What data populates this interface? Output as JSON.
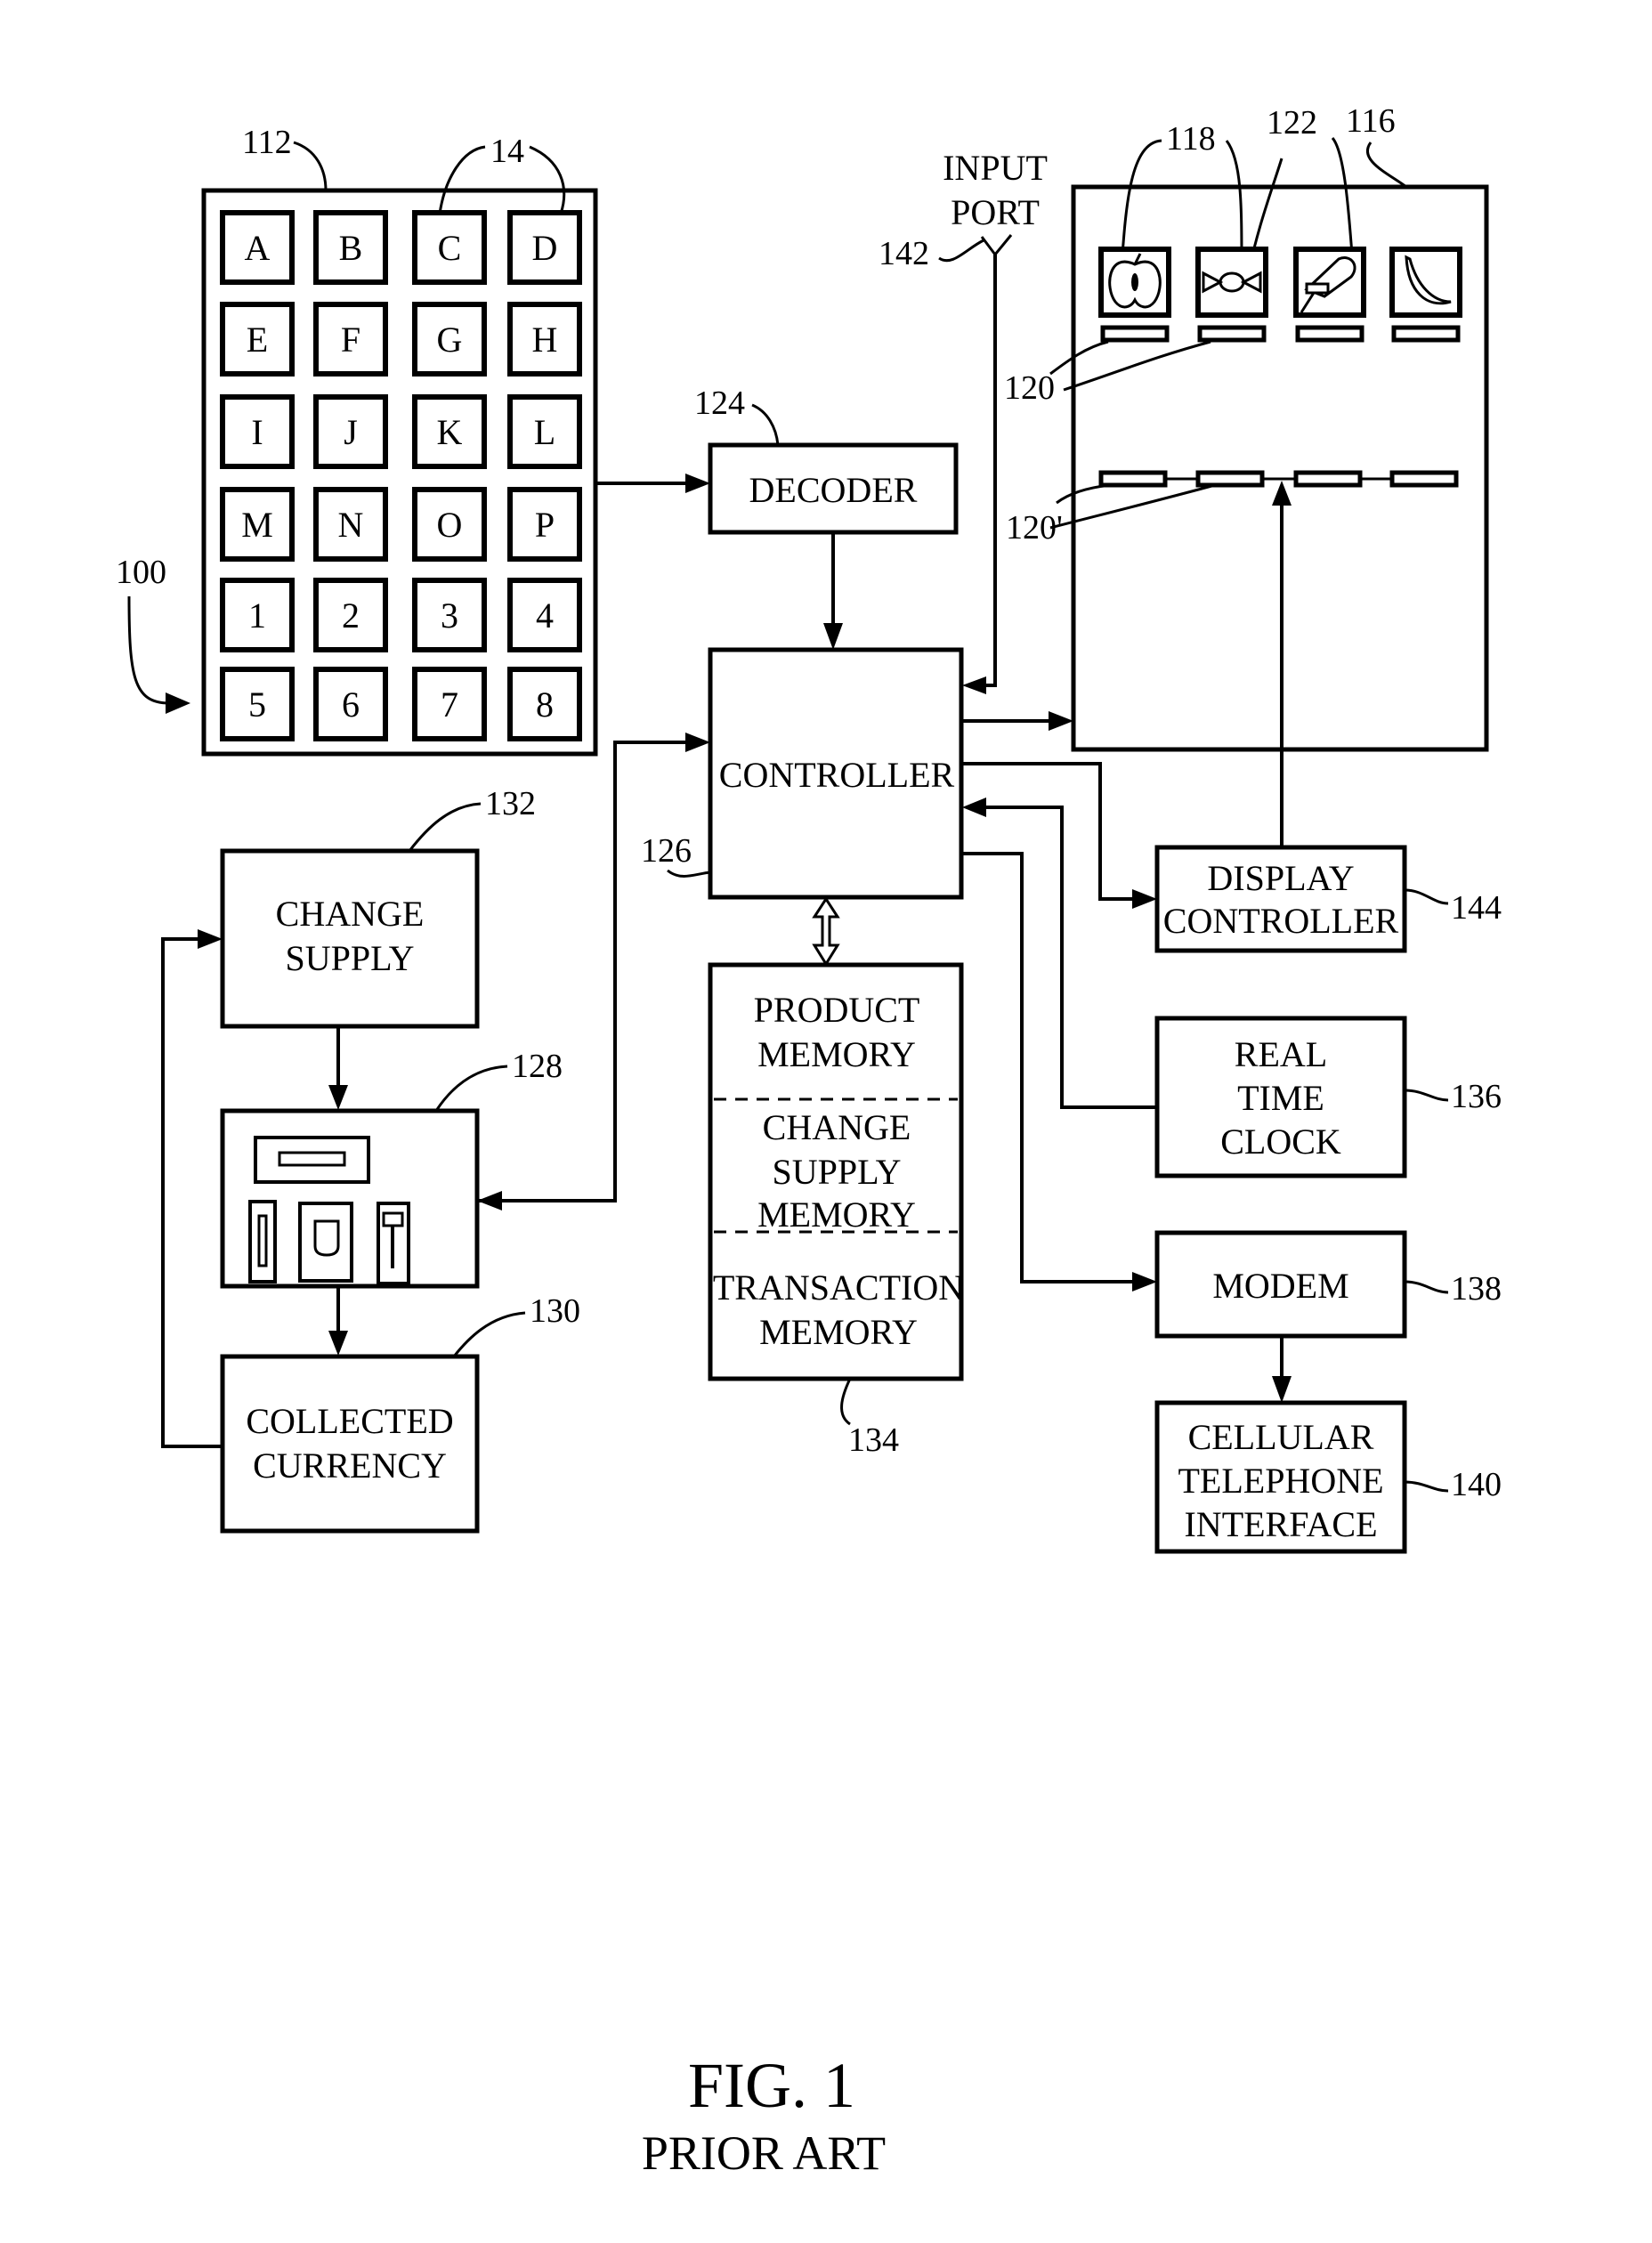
{
  "figure": {
    "title": "FIG. 1",
    "subtitle": "PRIOR ART"
  },
  "keypad": {
    "ref": "112",
    "key_ref": "14",
    "system_ref": "100",
    "keys": [
      "A",
      "B",
      "C",
      "D",
      "E",
      "F",
      "G",
      "H",
      "I",
      "J",
      "K",
      "L",
      "M",
      "N",
      "O",
      "P",
      "1",
      "2",
      "3",
      "4",
      "5",
      "6",
      "7",
      "8"
    ]
  },
  "input_port": {
    "line1": "INPUT",
    "line2": "PORT",
    "ref": "142"
  },
  "decoder": {
    "label": "DECODER",
    "ref": "124"
  },
  "controller": {
    "label": "CONTROLLER",
    "ref": "126"
  },
  "display": {
    "ref": "116",
    "product_ref": "118",
    "image_ref": "122",
    "label_ref": "120",
    "label_ref_alt": "120'",
    "products": [
      "apple-icon",
      "candy-icon",
      "ice-cream-bar-icon",
      "banana-icon"
    ]
  },
  "display_controller": {
    "line1": "DISPLAY",
    "line2": "CONTROLLER",
    "ref": "144"
  },
  "real_time_clock": {
    "line1": "REAL",
    "line2": "TIME",
    "line3": "CLOCK",
    "ref": "136"
  },
  "modem": {
    "label": "MODEM",
    "ref": "138"
  },
  "cellular": {
    "line1": "CELLULAR",
    "line2": "TELEPHONE",
    "line3": "INTERFACE",
    "ref": "140"
  },
  "memory": {
    "ref": "134",
    "sections": [
      {
        "line1": "PRODUCT",
        "line2": "MEMORY"
      },
      {
        "line1": "CHANGE",
        "line2": "SUPPLY",
        "line3": "MEMORY"
      },
      {
        "line1": "TRANSACTION",
        "line2": "MEMORY"
      }
    ]
  },
  "change_supply": {
    "line1": "CHANGE",
    "line2": "SUPPLY",
    "ref": "132"
  },
  "coin_mechanism": {
    "ref": "128"
  },
  "collected_currency": {
    "line1": "COLLECTED",
    "line2": "CURRENCY",
    "ref": "130"
  }
}
